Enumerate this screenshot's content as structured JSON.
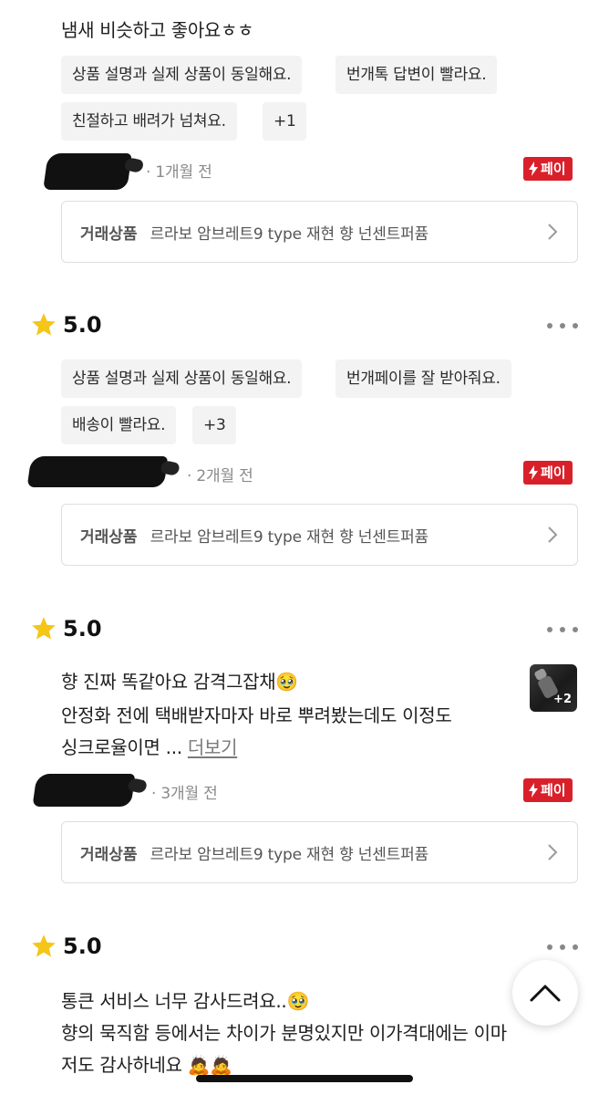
{
  "reviews": [
    {
      "text_lines": [
        "냄새 비슷하고 좋아요ㅎㅎ"
      ],
      "tags": [
        "상품 설명과 실제 상품이 동일해요.",
        "번개톡 답변이 빨라요.",
        "친절하고 배려가 넘쳐요.",
        "+1"
      ],
      "time": "· 1개월 전",
      "pay_label": "페이",
      "trade_label": "거래상품",
      "trade_product": "르라보 암브레트9 type 재현 향 넌센트퍼퓸"
    },
    {
      "rating": "5.0",
      "tags": [
        "상품 설명과 실제 상품이 동일해요.",
        "번개페이를 잘 받아줘요.",
        "배송이 빨라요.",
        "+3"
      ],
      "time": "· 2개월 전",
      "pay_label": "페이",
      "trade_label": "거래상품",
      "trade_product": "르라보 암브레트9 type 재현 향 넌센트퍼퓸"
    },
    {
      "rating": "5.0",
      "text_lines": [
        "향 진짜 똑같아요 감격그잡채🥹",
        "안정화 전에 택배받자마자 바로 뿌려봤는데도 이정도",
        "싱크로율이면 ..."
      ],
      "more_label": "더보기",
      "photo_count": "+2",
      "time": "· 3개월 전",
      "pay_label": "페이",
      "trade_label": "거래상품",
      "trade_product": "르라보 암브레트9 type 재현 향 넌센트퍼퓸"
    },
    {
      "rating": "5.0",
      "text_lines": [
        "통큰 서비스 너무 감사드려요..🥹",
        "향의 묵직함 등에서는 차이가 분명있지만 이가격대에는 이마",
        "저도 감사하네요 🙇🙇"
      ]
    }
  ],
  "icons": {
    "star": "star-icon",
    "more": "more-options-icon",
    "chevron": "chevron-right-icon",
    "bolt": "lightning-icon",
    "scroll_top": "chevron-up-icon"
  },
  "colors": {
    "pay_badge": "#d9202a",
    "star": "#f5c518",
    "tag_bg": "#f3f3f3"
  }
}
